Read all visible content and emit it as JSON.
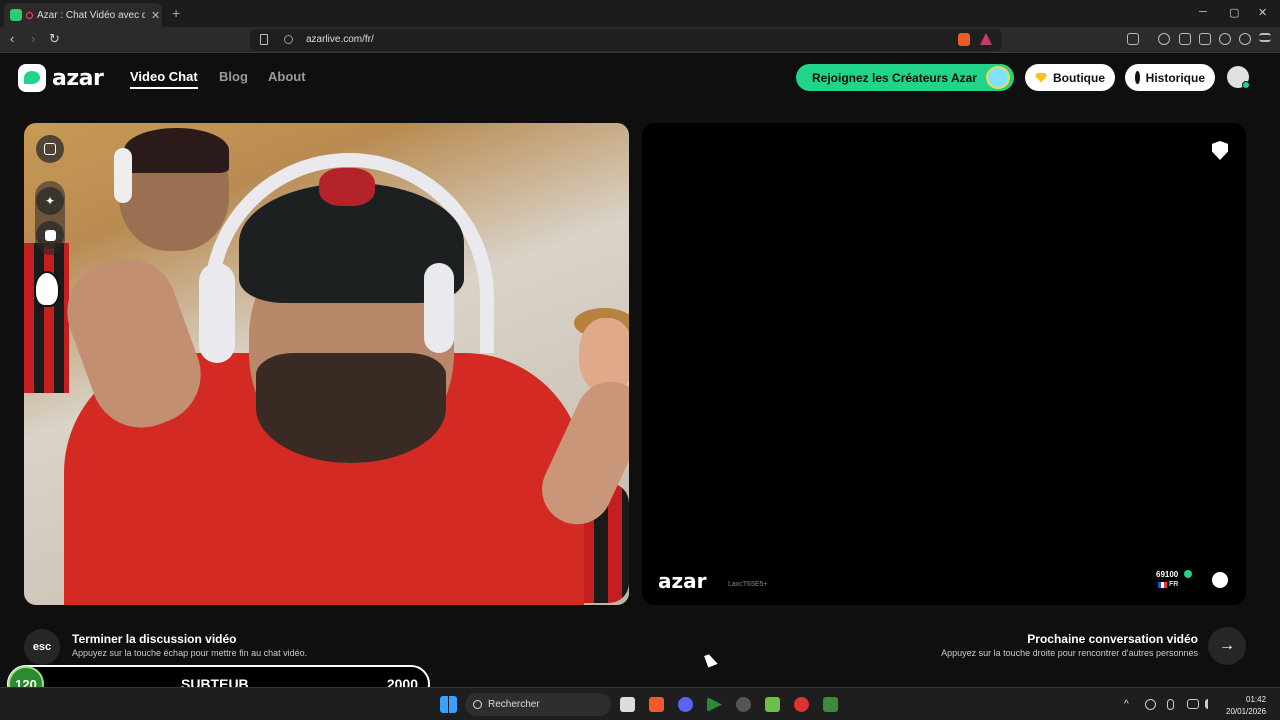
{
  "browser": {
    "tab_title": "Azar : Chat Vidéo avec de no",
    "tab_close": "✕",
    "new_tab": "+",
    "url": "azarlive.com/fr/",
    "win_min": "─",
    "win_max": "▢",
    "win_close": "✕",
    "back": "‹",
    "forward": "›",
    "reload": "↻"
  },
  "site": {
    "logo": "azar",
    "nav": [
      {
        "label": "Video Chat",
        "active": true
      },
      {
        "label": "Blog"
      },
      {
        "label": "About"
      }
    ],
    "creators_button": "Rejoignez les Créateurs Azar",
    "shop_button": "Boutique",
    "history_button": "Historique"
  },
  "remote": {
    "logo": "azar",
    "user_id": "LaxcT65E5+",
    "score": "69100",
    "country": "FR"
  },
  "controls": {
    "end_key": "esc",
    "end_title": "Terminer la discussion vidéo",
    "end_sub": "Appuyez sur la touche échap pour mettre fin au chat vidéo.",
    "next_title": "Prochaine conversation vidéo",
    "next_sub": "Appuyez sur la touche droite pour rencontrer d'autres personnes",
    "next_arrow": "→"
  },
  "overlay": {
    "count": "120",
    "label": "SUBTEUB",
    "goal": "2000"
  },
  "taskbar": {
    "search_placeholder": "Rechercher",
    "time": "01:42",
    "date": "20/01/2026"
  },
  "colors": {
    "accent": "#22d48a",
    "shirt": "#d42a24",
    "background": "#0f0f0f"
  }
}
